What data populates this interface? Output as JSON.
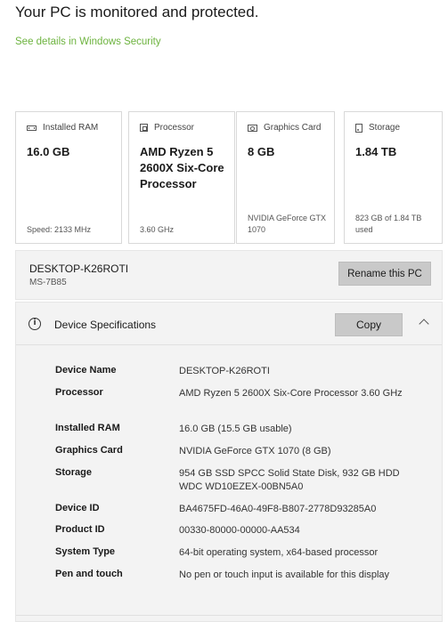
{
  "header": {
    "status": "Your PC is monitored and protected.",
    "security_link": "See details in Windows Security"
  },
  "cards": [
    {
      "label": "Installed RAM",
      "icon": "ram-icon",
      "value": "16.0 GB",
      "footer": "Speed: 2133 MHz"
    },
    {
      "label": "Processor",
      "icon": "processor-icon",
      "value": "AMD Ryzen 5 2600X Six-Core Processor",
      "footer": "3.60 GHz"
    },
    {
      "label": "Graphics Card",
      "icon": "graphics-card-icon",
      "value": "8 GB",
      "footer": "NVIDIA GeForce GTX 1070"
    },
    {
      "label": "Storage",
      "icon": "storage-icon",
      "value": "1.84 TB",
      "footer": "823 GB of 1.84 TB used"
    }
  ],
  "pc": {
    "name": "DESKTOP-K26ROTI",
    "model": "MS-7B85",
    "rename_label": "Rename this PC"
  },
  "specs": {
    "title": "Device Specifications",
    "copy_label": "Copy",
    "rows": [
      {
        "label": "Device Name",
        "value": "DESKTOP-K26ROTI"
      },
      {
        "label": "Processor",
        "value": "AMD Ryzen 5 2600X Six-Core Processor 3.60 GHz"
      },
      {
        "label": "Installed RAM",
        "value": "16.0 GB (15.5 GB usable)"
      },
      {
        "label": "Graphics Card",
        "value": "NVIDIA GeForce GTX 1070 (8 GB)"
      },
      {
        "label": "Storage",
        "value": "954 GB SSD SPCC Solid State Disk, 932 GB HDD WDC WD10EZEX-00BN5A0"
      },
      {
        "label": "Device ID",
        "value": "BA4675FD-46A0-49F8-B807-2778D93285A0"
      },
      {
        "label": "Product ID",
        "value": "00330-80000-00000-AA534"
      },
      {
        "label": "System Type",
        "value": "64-bit operating system, x64-based processor"
      },
      {
        "label": "Pen and touch",
        "value": "No pen or touch input is available for this display"
      }
    ]
  },
  "colors": {
    "link": "#6db33f",
    "button": "#c9c9c9",
    "panel": "#f3f3f3"
  }
}
